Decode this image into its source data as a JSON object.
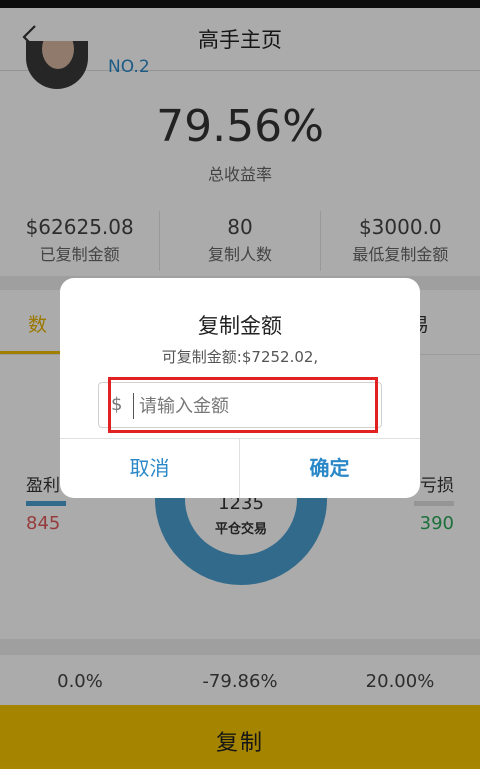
{
  "nav": {
    "title": "高手主页"
  },
  "profile": {
    "rank": "NO.2"
  },
  "summary": {
    "return_pct": "79.56%",
    "return_label": "总收益率"
  },
  "stats": [
    {
      "value": "$62625.08",
      "label": "已复制金额"
    },
    {
      "value": "80",
      "label": "复制人数"
    },
    {
      "value": "$3000.0",
      "label": "最低复制金额"
    }
  ],
  "tabs": {
    "left": "数",
    "right": "易"
  },
  "chart": {
    "left_label": "盈利",
    "left_value": "845",
    "center_value": "1235",
    "center_label": "平仓交易",
    "right_label": "亏损",
    "right_value": "390"
  },
  "bottom_stats": [
    {
      "value": "0.0%",
      "label": ""
    },
    {
      "value": "-79.86%",
      "label": ""
    },
    {
      "value": "20.00%",
      "label": ""
    }
  ],
  "copy_button": "复制",
  "dialog": {
    "title": "复制金额",
    "subtitle": "可复制金额:$7252.02,",
    "currency": "$",
    "placeholder": "请输入金额",
    "cancel": "取消",
    "confirm": "确定"
  },
  "colors": {
    "accent": "#f7c600",
    "link": "#2a88c8",
    "highlight": "#e02222"
  }
}
